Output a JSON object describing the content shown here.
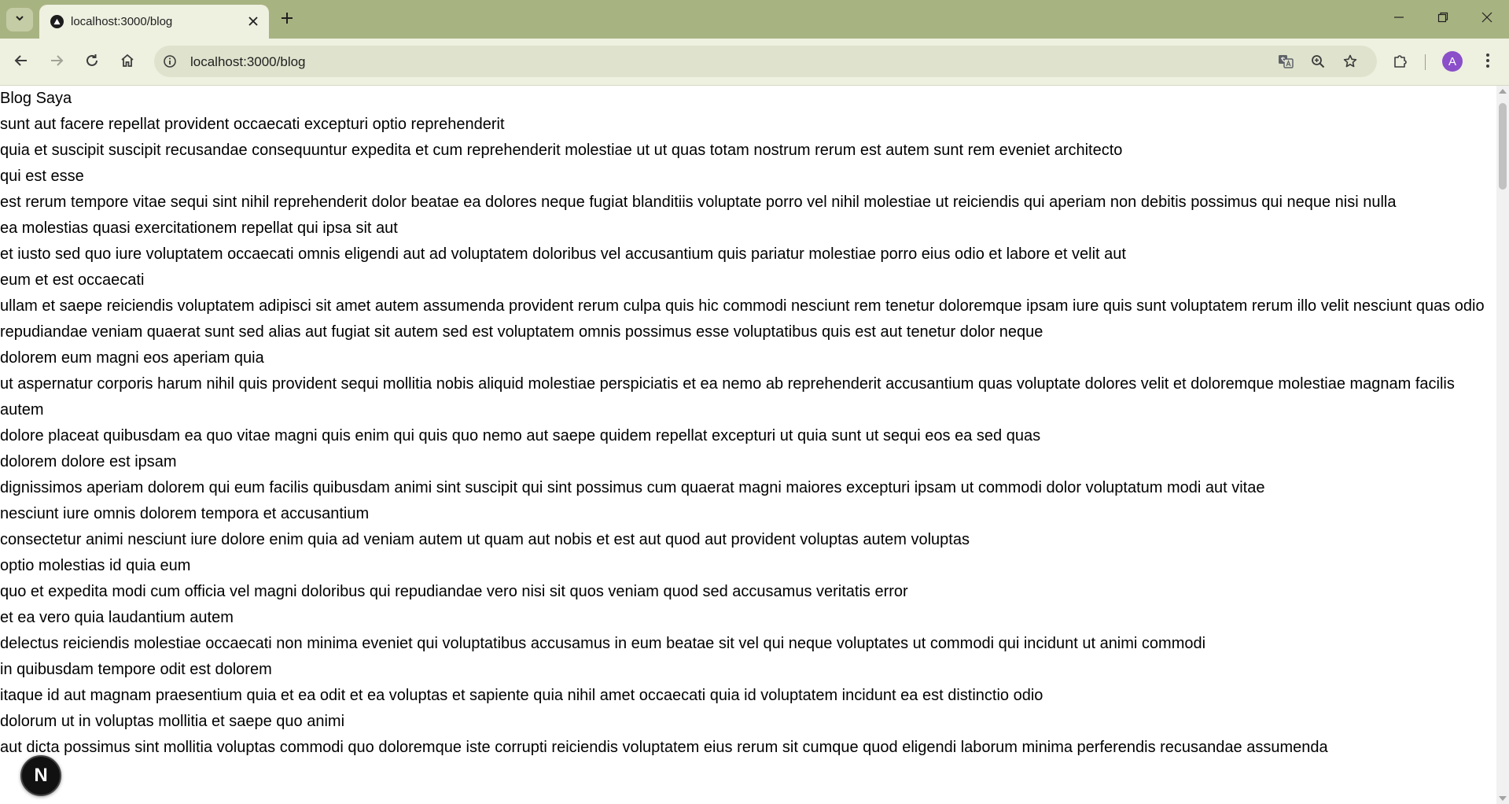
{
  "browser": {
    "tab_title": "localhost:3000/blog",
    "url": "localhost:3000/blog",
    "avatar_letter": "A",
    "colors": {
      "frame": "#a8b382",
      "toolbar": "#eef0e0",
      "omnibox": "#dfe3cd",
      "avatar": "#8a4fc9"
    }
  },
  "icons": {
    "tab_search": "chevron-down-icon",
    "favicon": "nextjs-triangle-icon",
    "close": "close-icon",
    "new_tab": "plus-icon",
    "back": "arrow-left-icon",
    "forward": "arrow-right-icon",
    "reload": "reload-icon",
    "home": "home-icon",
    "site_info": "info-icon",
    "translate": "translate-icon",
    "zoom": "zoom-icon",
    "bookmark": "star-icon",
    "extensions": "puzzle-icon",
    "menu": "kebab-menu-icon"
  },
  "page": {
    "title": "Blog Saya",
    "lines": [
      "sunt aut facere repellat provident occaecati excepturi optio reprehenderit",
      "quia et suscipit suscipit recusandae consequuntur expedita et cum reprehenderit molestiae ut ut quas totam nostrum rerum est autem sunt rem eveniet architecto",
      "qui est esse",
      "est rerum tempore vitae sequi sint nihil reprehenderit dolor beatae ea dolores neque fugiat blanditiis voluptate porro vel nihil molestiae ut reiciendis qui aperiam non debitis possimus qui neque nisi nulla",
      "ea molestias quasi exercitationem repellat qui ipsa sit aut",
      "et iusto sed quo iure voluptatem occaecati omnis eligendi aut ad voluptatem doloribus vel accusantium quis pariatur molestiae porro eius odio et labore et velit aut",
      "eum et est occaecati",
      "ullam et saepe reiciendis voluptatem adipisci sit amet autem assumenda provident rerum culpa quis hic commodi nesciunt rem tenetur doloremque ipsam iure quis sunt voluptatem rerum illo velit nesciunt quas odio",
      "repudiandae veniam quaerat sunt sed alias aut fugiat sit autem sed est voluptatem omnis possimus esse voluptatibus quis est aut tenetur dolor neque",
      "dolorem eum magni eos aperiam quia",
      "ut aspernatur corporis harum nihil quis provident sequi mollitia nobis aliquid molestiae perspiciatis et ea nemo ab reprehenderit accusantium quas voluptate dolores velit et doloremque molestiae magnam facilis autem",
      "dolore placeat quibusdam ea quo vitae magni quis enim qui quis quo nemo aut saepe quidem repellat excepturi ut quia sunt ut sequi eos ea sed quas",
      "dolorem dolore est ipsam",
      "dignissimos aperiam dolorem qui eum facilis quibusdam animi sint suscipit qui sint possimus cum quaerat magni maiores excepturi ipsam ut commodi dolor voluptatum modi aut vitae",
      "nesciunt iure omnis dolorem tempora et accusantium",
      "consectetur animi nesciunt iure dolore enim quia ad veniam autem ut quam aut nobis et est aut quod aut provident voluptas autem voluptas",
      "optio molestias id quia eum",
      "quo et expedita modi cum officia vel magni doloribus qui repudiandae vero nisi sit quos veniam quod sed accusamus veritatis error",
      "et ea vero quia laudantium autem",
      "delectus reiciendis molestiae occaecati non minima eveniet qui voluptatibus accusamus in eum beatae sit vel qui neque voluptates ut commodi qui incidunt ut animi commodi",
      "in quibusdam tempore odit est dolorem",
      "itaque id aut magnam praesentium quia et ea odit et ea voluptas et sapiente quia nihil amet occaecati quia id voluptatem incidunt ea est distinctio odio",
      "dolorum ut in voluptas mollitia et saepe quo animi",
      "aut dicta possimus sint mollitia voluptas commodi quo doloremque iste corrupti reiciendis voluptatem eius rerum sit cumque quod eligendi laborum minima perferendis recusandae assumenda"
    ]
  },
  "dev_indicator": {
    "label": "N"
  }
}
